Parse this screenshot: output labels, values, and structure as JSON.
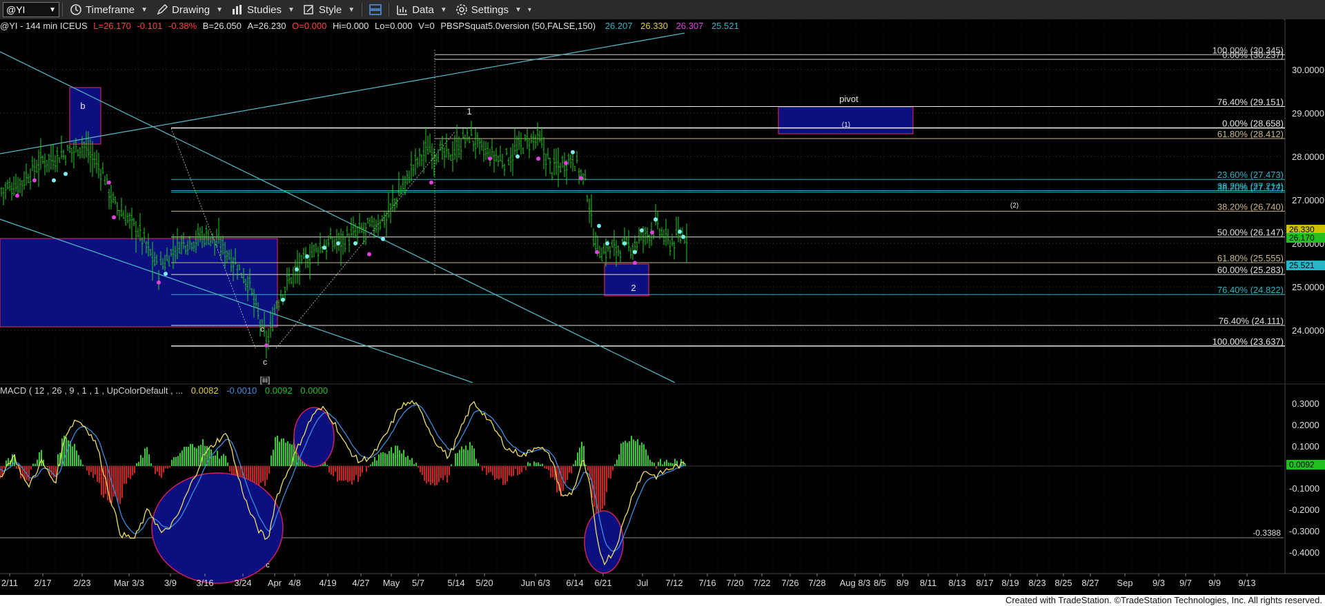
{
  "toolbar": {
    "symbol": "@YI",
    "items": [
      {
        "label": "Timeframe",
        "icon": "clock-icon"
      },
      {
        "label": "Drawing",
        "icon": "pencil-icon"
      },
      {
        "label": "Studies",
        "icon": "studies-icon"
      },
      {
        "label": "Style",
        "icon": "style-icon"
      },
      {
        "label": "",
        "icon": "layout-icon"
      },
      {
        "label": "Data",
        "icon": "bar-chart-icon"
      },
      {
        "label": "Settings",
        "icon": "gear-icon"
      }
    ]
  },
  "header": {
    "symbol": "@YI - 144 min  ICEUS",
    "last": "L=26.170",
    "change": "-0.101",
    "pct": "-0.38%",
    "bid": "B=26.050",
    "ask": "A=26.230",
    "open": "O=0.000",
    "hi": "Hi=0.000",
    "lo": "Lo=0.000",
    "vol": "V=0",
    "study": "PBSPSquat5.0version (50,FALSE,150)",
    "v1": "26.207",
    "v2": "26.330",
    "v3": "26.307",
    "v4": "25.521"
  },
  "macd_header": {
    "label": "MACD ( 12 , 26 , 9 , 1 , 1 , UpColorDefault , ...",
    "v1": "0.0082",
    "v2": "-0.0010",
    "v3": "0.0092",
    "v4": "0.0000"
  },
  "colors": {
    "up_bar": "#22cc22",
    "down_bar": "#cc2222",
    "box_fill": "#0c0f80",
    "box_border": "#cc2255",
    "cyan_line": "#4fb3c0",
    "axis_text": "#dcdcdc"
  },
  "price_axis": {
    "ticks": [
      "30.0000",
      "29.0000",
      "28.0000",
      "27.0000",
      "26.0000",
      "25.0000",
      "24.0000"
    ],
    "badges": [
      {
        "text": "26.330",
        "color": "#ccc000"
      },
      {
        "text": "26.170",
        "color": "#21c021"
      },
      {
        "text": "25.521",
        "color": "#21b9c9"
      }
    ]
  },
  "macd_axis": {
    "ticks": [
      "0.3000",
      "0.2000",
      "0.1000",
      "-0.1000",
      "-0.2000",
      "-0.3000",
      "-0.4000"
    ],
    "badge": "0.0092",
    "level_label": "-0.3388"
  },
  "fib_labels": [
    {
      "text": "100.00% (30.345)",
      "color": "#d0d0d0"
    },
    {
      "text": "0.00% (30.237)",
      "color": "#d0d0d0"
    },
    {
      "text": "76.40% (29.151)",
      "color": "#e8e8e8"
    },
    {
      "text": "0.00% (28.658)",
      "color": "#e8e8e8"
    },
    {
      "text": "61.80% (28.412)",
      "color": "#c8b98a"
    },
    {
      "text": "23.60% (27.473)",
      "color": "#2fb4c4"
    },
    {
      "text": "38.20% (27.214)",
      "color": "#2fb4c4"
    },
    {
      "text": "38.20% (27.177)",
      "color": "#2fb4c4"
    },
    {
      "text": "38.20% (26.740)",
      "color": "#c8b98a"
    },
    {
      "text": "50.00% (26.147)",
      "color": "#e0e0e0"
    },
    {
      "text": "61.80% (25.555)",
      "color": "#c8b98a"
    },
    {
      "text": "60.00% (25.283)",
      "color": "#e0e0e0"
    },
    {
      "text": "76.40% (24.822)",
      "color": "#2fb4c4"
    },
    {
      "text": "76.40% (24.111)",
      "color": "#e0e0e0"
    },
    {
      "text": "100.00% (23.637)",
      "color": "#e8e8e8"
    }
  ],
  "annotations": {
    "b": "b",
    "c_low": "c",
    "c_box": "c",
    "c_macd": "c",
    "iii": "[iii]",
    "wave1": "1",
    "wave2": "2",
    "pivot": "pivot",
    "w1_paren": "(1)",
    "w2_paren": "(2)"
  },
  "time_axis": [
    "2/11",
    "2/17",
    "2/23",
    "Mar 3/3",
    "3/9",
    "3/16",
    "3/24",
    "Apr",
    "4/8",
    "4/19",
    "4/27",
    "May",
    "5/7",
    "5/14",
    "5/20",
    "Jun 6/3",
    "6/14",
    "6/21",
    "Jul",
    "7/12",
    "7/16",
    "7/20",
    "7/22",
    "7/26",
    "7/28",
    "Aug 8/3",
    "8/5",
    "8/9",
    "8/11",
    "8/13",
    "8/17",
    "8/19",
    "8/23",
    "8/25",
    "8/27",
    "Sep",
    "9/3",
    "9/7",
    "9/9",
    "9/13"
  ],
  "footer": "Created with TradeStation. ©TradeStation Technologies, Inc. All rights reserved."
}
